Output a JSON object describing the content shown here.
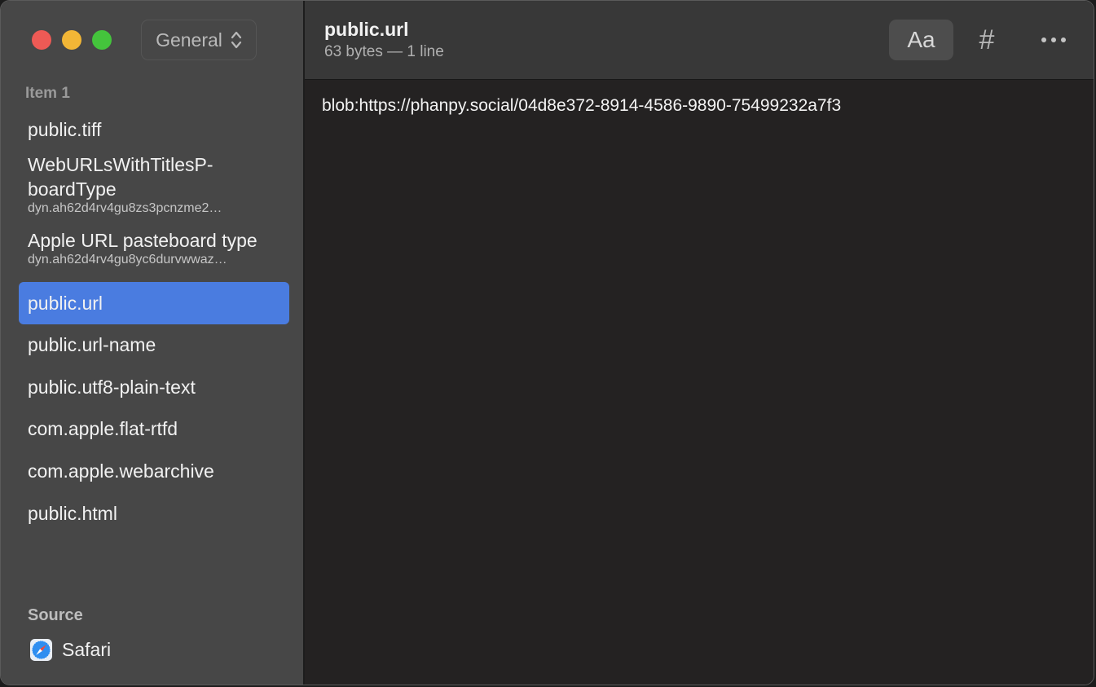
{
  "window": {
    "traffic_lights": {
      "red": "#ee5a55",
      "yellow": "#f2b636",
      "green": "#44c43c"
    },
    "accent": "#4a7ce0"
  },
  "sidebar": {
    "popup": {
      "label": "General",
      "icon": "chevron-up-down-icon"
    },
    "section_label": "Item 1",
    "items": [
      {
        "title": "public.tiff",
        "subtitle": ""
      },
      {
        "title": "WebURLsWithTitlesP-",
        "title2": "boardType",
        "subtitle": "dyn.ah62d4rv4gu8zs3pcnzme2…"
      },
      {
        "title": "Apple URL pasteboard type",
        "subtitle": "dyn.ah62d4rv4gu8yc6durvwwaz…"
      },
      {
        "title": "public.url",
        "subtitle": "",
        "selected": true
      },
      {
        "title": "public.url-name",
        "subtitle": ""
      },
      {
        "title": "public.utf8-plain-text",
        "subtitle": ""
      },
      {
        "title": "com.apple.flat-rtfd",
        "subtitle": ""
      },
      {
        "title": "com.apple.webarchive",
        "subtitle": ""
      },
      {
        "title": "public.html",
        "subtitle": ""
      }
    ],
    "source_label": "Source",
    "source_app": {
      "name": "Safari",
      "icon": "safari-compass-icon"
    }
  },
  "toolbar": {
    "title": "public.url",
    "subtitle": "63 bytes — 1 line",
    "font_button": "Aa",
    "hash_button": "#",
    "more_icon": "ellipsis-icon"
  },
  "content": {
    "text": "blob:https://phanpy.social/04d8e372-8914-4586-9890-75499232a7f3"
  }
}
